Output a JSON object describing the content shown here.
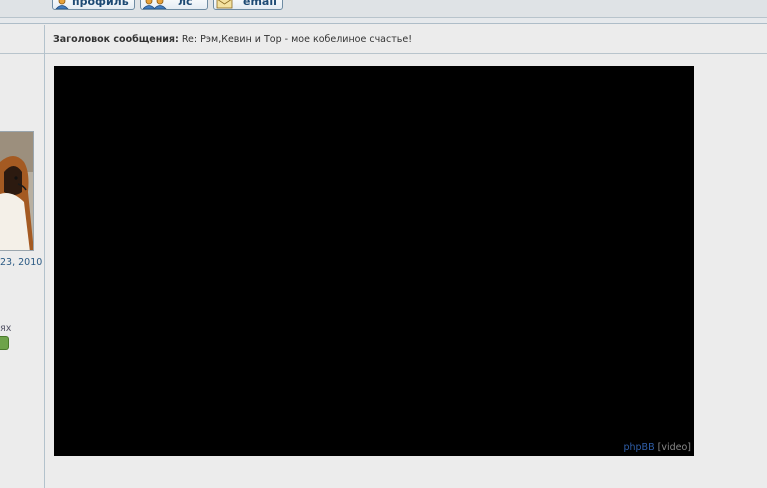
{
  "profile_buttons": {
    "profile": "профиль",
    "pm": "лс",
    "email": "email"
  },
  "post": {
    "title_label": "Заголовок сообщения:",
    "title_value": "Re: Рэм,Кевин и Тор - мое кобелиное счастье!"
  },
  "sidebar": {
    "date_fragment": "23, 2010",
    "text_fragment": "ях"
  },
  "video": {
    "credit_link": "phpBB",
    "credit_suffix": "[video]"
  },
  "colors": {
    "background": "#ececec",
    "button_text": "#1d4a74",
    "link": "#2f5ea8"
  }
}
